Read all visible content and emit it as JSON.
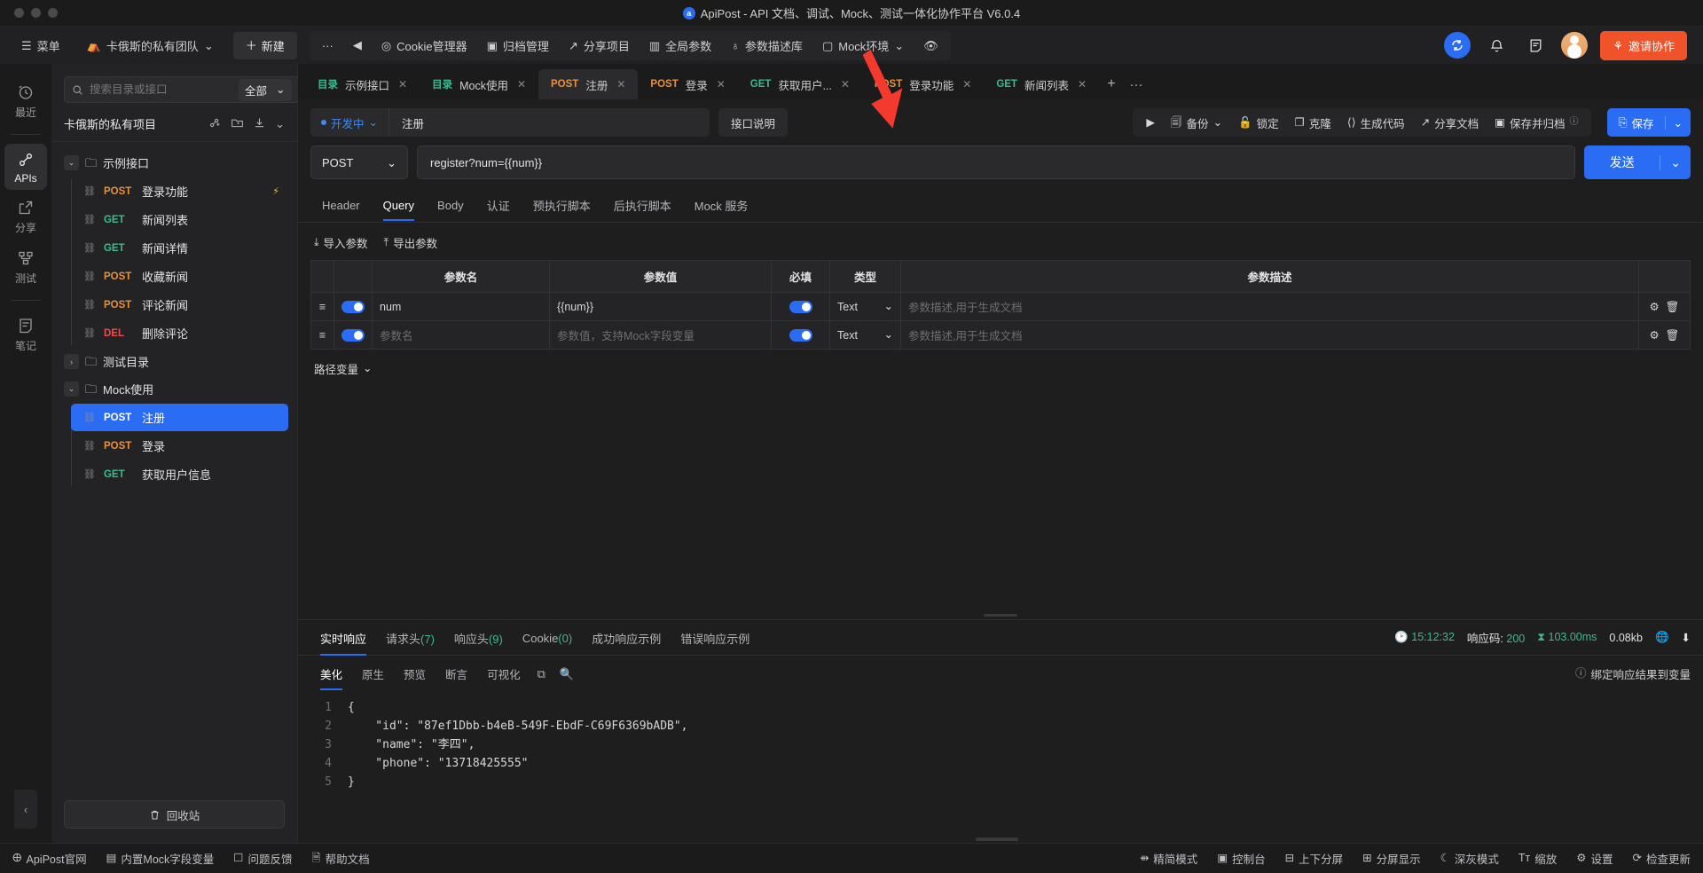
{
  "window": {
    "title": "ApiPost - API 文档、调试、Mock、测试一体化协作平台 V6.0.4",
    "logo_glyph": "a"
  },
  "topnav": {
    "menu": "菜单",
    "team": "卡俄斯的私有团队",
    "new": "新建",
    "more": "···",
    "back": "◀",
    "items": [
      {
        "label": "Cookie管理器",
        "icon": "cookie-icon"
      },
      {
        "label": "归档管理",
        "icon": "archive-icon"
      },
      {
        "label": "分享项目",
        "icon": "share-icon"
      },
      {
        "label": "全局参数",
        "icon": "global-params-icon"
      },
      {
        "label": "参数描述库",
        "icon": "param-lib-icon"
      },
      {
        "label": "Mock环境",
        "icon": "mock-env-icon"
      }
    ],
    "eye_icon": "eye-icon",
    "invite": "邀请协作",
    "colors": {
      "accent": "#2b6cf5",
      "invite": "#f0522a"
    }
  },
  "rail": {
    "items": [
      {
        "label": "最近",
        "icon": "clock-icon",
        "active": false
      },
      {
        "label": "APIs",
        "icon": "link-icon",
        "active": true
      },
      {
        "label": "分享",
        "icon": "share-box-icon",
        "active": false
      },
      {
        "label": "测试",
        "icon": "flow-icon",
        "active": false
      },
      {
        "label": "笔记",
        "icon": "note-icon",
        "active": false
      }
    ],
    "collapse": "‹"
  },
  "sidebar": {
    "search_placeholder": "搜索目录或接口",
    "search_value": "",
    "scope": "全部",
    "project": "卡俄斯的私有项目",
    "trash": "回收站",
    "tree": [
      {
        "type": "folder",
        "name": "示例接口",
        "expanded": true,
        "children": [
          {
            "method": "POST",
            "name": "登录功能",
            "bolt": true
          },
          {
            "method": "GET",
            "name": "新闻列表"
          },
          {
            "method": "GET",
            "name": "新闻详情"
          },
          {
            "method": "POST",
            "name": "收藏新闻"
          },
          {
            "method": "POST",
            "name": "评论新闻"
          },
          {
            "method": "DEL",
            "name": "删除评论"
          }
        ]
      },
      {
        "type": "folder",
        "name": "测试目录",
        "expanded": false,
        "children": []
      },
      {
        "type": "folder",
        "name": "Mock使用",
        "expanded": true,
        "children": [
          {
            "method": "POST",
            "name": "注册",
            "selected": true
          },
          {
            "method": "POST",
            "name": "登录"
          },
          {
            "method": "GET",
            "name": "获取用户信息"
          }
        ]
      }
    ]
  },
  "tabs": [
    {
      "kind": "目录",
      "label": "示例接口",
      "active": false
    },
    {
      "kind": "目录",
      "label": "Mock使用",
      "active": false
    },
    {
      "kind": "POST",
      "label": "注册",
      "active": true
    },
    {
      "kind": "POST",
      "label": "登录",
      "active": false
    },
    {
      "kind": "GET",
      "label": "获取用户...",
      "active": false
    },
    {
      "kind": "POST",
      "label": "登录功能",
      "active": false
    },
    {
      "kind": "GET",
      "label": "新闻列表",
      "active": false
    }
  ],
  "tab_add": "+",
  "tab_more": "···",
  "request": {
    "status": "开发中",
    "name": "注册",
    "desc_button": "接口说明",
    "method": "POST",
    "url": "register?num={{num}}",
    "send": "发送",
    "toolbar": [
      {
        "label": "",
        "icon": "play-icon"
      },
      {
        "label": "备份",
        "icon": "backup-icon",
        "caret": true
      },
      {
        "label": "锁定",
        "icon": "lock-icon"
      },
      {
        "label": "克隆",
        "icon": "clone-icon"
      },
      {
        "label": "生成代码",
        "icon": "code-icon"
      },
      {
        "label": "分享文档",
        "icon": "share-doc-icon"
      },
      {
        "label": "保存并归档",
        "icon": "save-archive-icon",
        "help": true
      }
    ],
    "save": "保存"
  },
  "param_tabs": [
    {
      "label": "Header",
      "active": false
    },
    {
      "label": "Query",
      "active": true
    },
    {
      "label": "Body",
      "active": false
    },
    {
      "label": "认证",
      "active": false
    },
    {
      "label": "预执行脚本",
      "active": false
    },
    {
      "label": "后执行脚本",
      "active": false
    },
    {
      "label": "Mock 服务",
      "active": false
    }
  ],
  "param_actions": [
    {
      "label": "导入参数",
      "icon": "import-icon"
    },
    {
      "label": "导出参数",
      "icon": "export-icon"
    }
  ],
  "param_table": {
    "headers": [
      "",
      "",
      "参数名",
      "参数值",
      "必填",
      "类型",
      "参数描述"
    ],
    "rows": [
      {
        "enabled": true,
        "name": "num",
        "name_placeholder": "参数名",
        "value": "{{num}}",
        "value_placeholder": "参数值，支持Mock字段变量",
        "required": true,
        "type": "Text",
        "desc": "",
        "desc_placeholder": "参数描述,用于生成文档"
      },
      {
        "enabled": true,
        "name": "",
        "name_placeholder": "参数名",
        "value": "",
        "value_placeholder": "参数值，支持Mock字段变量",
        "required": true,
        "type": "Text",
        "desc": "",
        "desc_placeholder": "参数描述,用于生成文档"
      }
    ]
  },
  "path_variable": "路径变量",
  "response": {
    "tabs": [
      {
        "label": "实时响应",
        "count": "",
        "active": true
      },
      {
        "label": "请求头",
        "count": "(7)",
        "active": false
      },
      {
        "label": "响应头",
        "count": "(9)",
        "active": false
      },
      {
        "label": "Cookie",
        "count": "(0)",
        "active": false
      },
      {
        "label": "成功响应示例",
        "count": "",
        "active": false
      },
      {
        "label": "错误响应示例",
        "count": "",
        "active": false
      }
    ],
    "meta": {
      "time": "15:12:32",
      "code_label": "响应码:",
      "code": "200",
      "duration": "103.00ms",
      "size": "0.08kb",
      "globe_icon": "globe-icon",
      "download_icon": "download-icon"
    },
    "view_tabs": [
      {
        "label": "美化",
        "active": true
      },
      {
        "label": "原生",
        "active": false
      },
      {
        "label": "预览",
        "active": false
      },
      {
        "label": "断言",
        "active": false
      },
      {
        "label": "可视化",
        "active": false
      }
    ],
    "copy_icon": "copy-icon",
    "search_icon": "search-icon",
    "bind_label": "绑定响应结果到变量",
    "bind_icon": "help-icon",
    "code_lines": [
      {
        "n": "1",
        "text": "{"
      },
      {
        "n": "2",
        "text": "    \"id\": \"87ef1Dbb-b4eB-549F-EbdF-C69F6369bADB\","
      },
      {
        "n": "3",
        "text": "    \"name\": \"李四\","
      },
      {
        "n": "4",
        "text": "    \"phone\": \"13718425555\""
      },
      {
        "n": "5",
        "text": "}"
      }
    ]
  },
  "bottombar": {
    "left": [
      {
        "label": "ApiPost官网",
        "icon": "globe-icon"
      },
      {
        "label": "内置Mock字段变量",
        "icon": "mock-var-icon"
      },
      {
        "label": "问题反馈",
        "icon": "feedback-icon"
      },
      {
        "label": "帮助文档",
        "icon": "doc-icon"
      }
    ],
    "right": [
      {
        "label": "精简模式",
        "icon": "simple-icon"
      },
      {
        "label": "控制台",
        "icon": "console-icon"
      },
      {
        "label": "上下分屏",
        "icon": "split-v-icon"
      },
      {
        "label": "分屏显示",
        "icon": "split-h-icon"
      },
      {
        "label": "深灰模式",
        "icon": "moon-icon"
      },
      {
        "label": "缩放",
        "icon": "zoom-icon"
      },
      {
        "label": "设置",
        "icon": "gear-icon"
      },
      {
        "label": "检查更新",
        "icon": "update-icon"
      }
    ]
  }
}
